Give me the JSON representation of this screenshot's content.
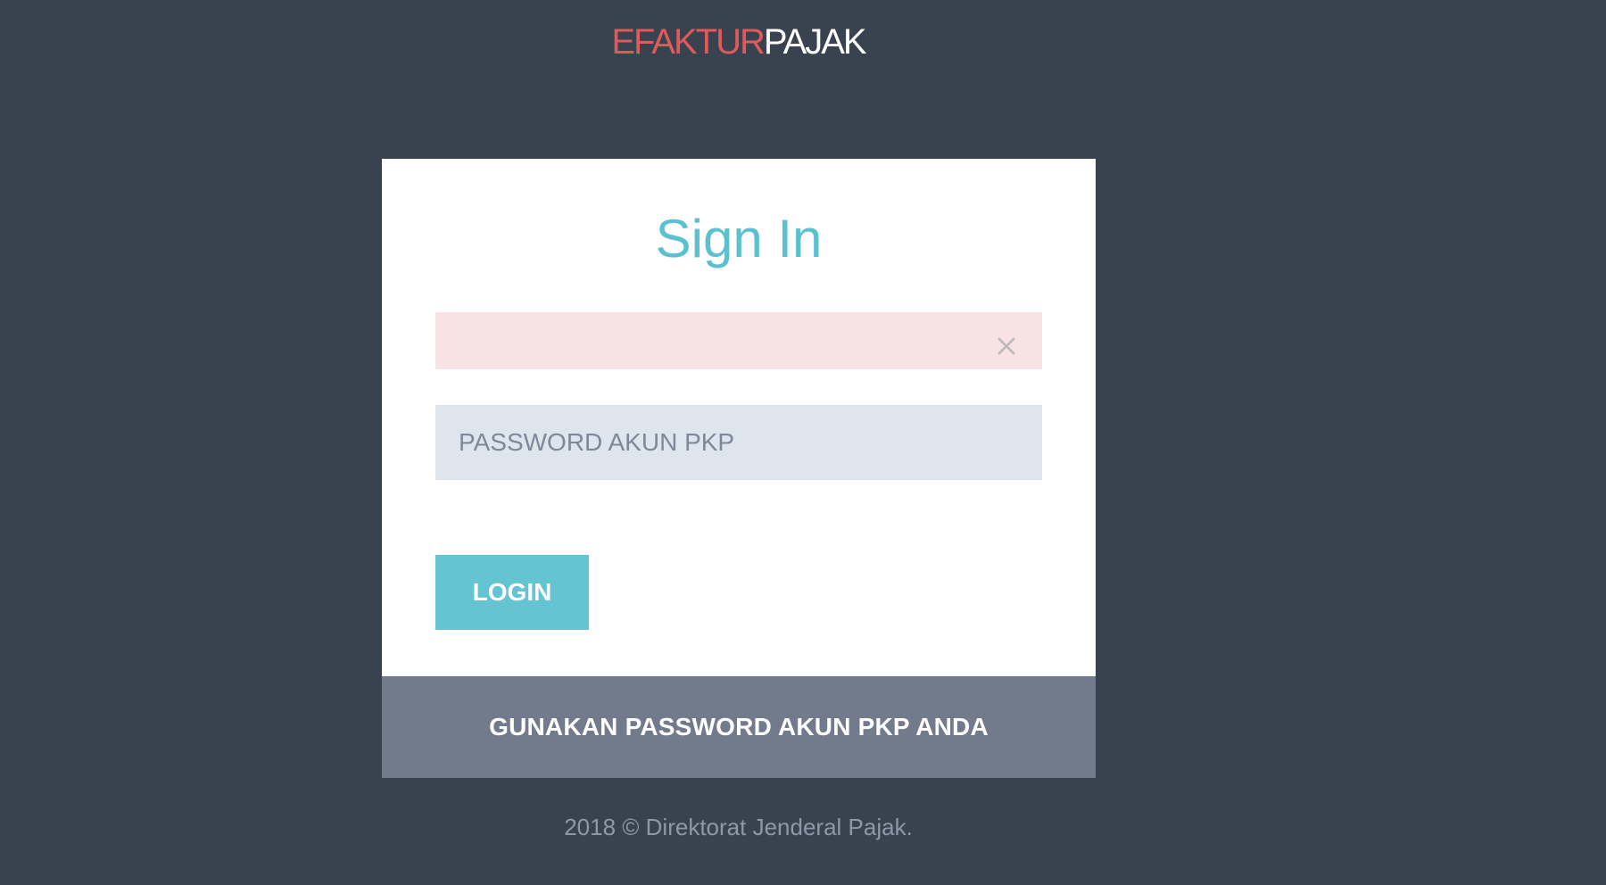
{
  "brand": {
    "part1": "EFAKTUR",
    "part2": "PAJAK",
    "colors": {
      "red": "#e05a5a",
      "white": "#ffffff"
    }
  },
  "card": {
    "title": "Sign In",
    "username": {
      "value": "",
      "placeholder": ""
    },
    "password": {
      "placeholder": "PASSWORD AKUN PKP"
    },
    "login_label": "LOGIN",
    "footer_link": "GUNAKAN PASSWORD AKUN PKP ANDA"
  },
  "footer": {
    "copyright": "2018 © Direktorat Jenderal Pajak."
  },
  "icons": {
    "clear": "close-icon"
  },
  "colors": {
    "background": "#39424f",
    "accent": "#5bc0cf",
    "button": "#65c4d1",
    "field_error": "#f7e3e3",
    "field": "#dfe5ec",
    "card_footer": "#727b8b"
  }
}
